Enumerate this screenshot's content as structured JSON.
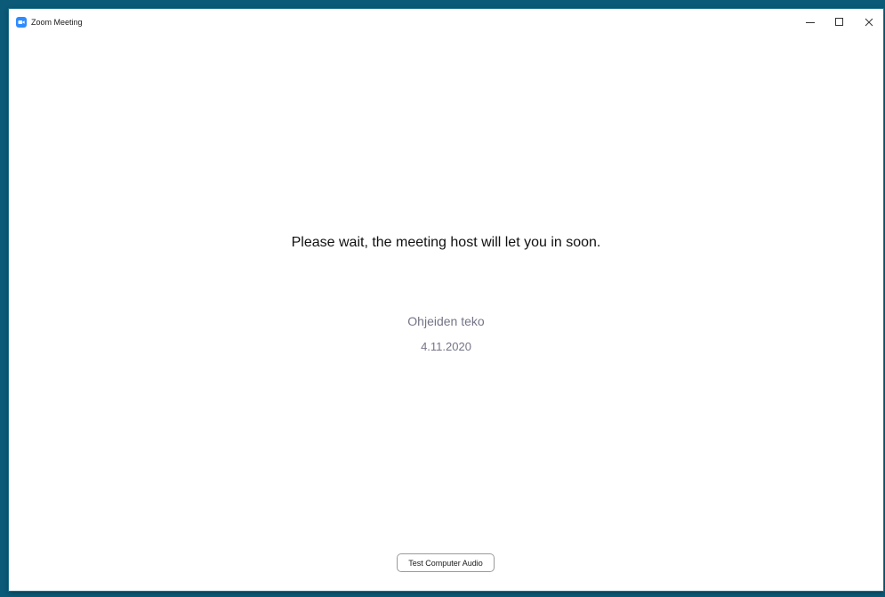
{
  "window": {
    "title": "Zoom Meeting",
    "app_icon": "zoom-logo-icon",
    "controls": [
      "minimize-icon",
      "maximize-icon",
      "close-icon"
    ],
    "accent_color": "#2d8cff",
    "desktop_color": "#0b5a78"
  },
  "waiting_room": {
    "message": "Please wait, the meeting host will let you in soon.",
    "meeting_topic": "Ohjeiden teko",
    "meeting_date": "4.11.2020"
  },
  "footer": {
    "test_audio_label": "Test Computer Audio"
  }
}
